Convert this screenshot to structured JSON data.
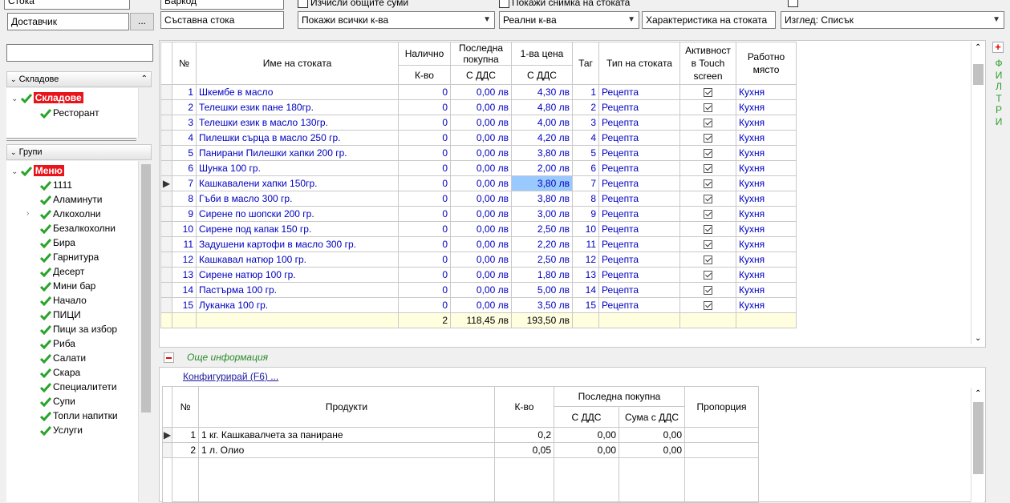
{
  "toolbar": {
    "stock_label": "Стока",
    "barcode_label": "Баркод",
    "calc_totals_label": "Изчисли общите суми",
    "show_photo_label": "Покажи снимка на стоката",
    "supplier_label": "Доставчик",
    "ellipsis_label": "...",
    "composite_label": "Съставна стока",
    "qty_filter_value": "Покажи всички к-ва",
    "real_qty_value": "Реални к-ва",
    "characteristic_label": "Характеристика на стоката",
    "view_value": "Изглед: Списък"
  },
  "left": {
    "warehouses_header": "Складове",
    "warehouses_root": "Складове",
    "warehouses_children": [
      "Ресторант"
    ],
    "groups_header": "Групи",
    "groups_root": "Меню",
    "groups": [
      "1111",
      "Аламинути",
      "Алкохолни",
      "Безалкохолни",
      "Бира",
      "Гарнитура",
      "Десерт",
      "Мини бар",
      "Начало",
      "ПИЦИ",
      "Пици за избор",
      "Риба",
      "Салати",
      "Скара",
      "Специалитети",
      "Супи",
      "Топли напитки",
      "Услуги"
    ]
  },
  "filters_label": "ФИЛТРИ",
  "main_grid": {
    "headers": {
      "no": "№",
      "name": "Име на стоката",
      "available": "Налично",
      "qty": "К-во",
      "last_purchase": "Последна покупна",
      "with_vat": "С ДДС",
      "first_price": "1-ва цена",
      "with_vat2": "С ДДС",
      "tag": "Таг",
      "type": "Тип на стоката",
      "touch": "Активност в Touch screen",
      "workplace": "Работно място"
    },
    "rows": [
      {
        "no": "1",
        "name": "Шкембе в масло",
        "qty": "0",
        "last": "0,00 лв",
        "price": "4,30 лв",
        "tag": "1",
        "type": "Рецепта",
        "wp": "Кухня"
      },
      {
        "no": "2",
        "name": "Телешки език пане 180гр.",
        "qty": "0",
        "last": "0,00 лв",
        "price": "4,80 лв",
        "tag": "2",
        "type": "Рецепта",
        "wp": "Кухня"
      },
      {
        "no": "3",
        "name": "Телешки език в масло 130гр.",
        "qty": "0",
        "last": "0,00 лв",
        "price": "4,00 лв",
        "tag": "3",
        "type": "Рецепта",
        "wp": "Кухня"
      },
      {
        "no": "4",
        "name": "Пилешки сърца в масло 250 гр.",
        "qty": "0",
        "last": "0,00 лв",
        "price": "4,20 лв",
        "tag": "4",
        "type": "Рецепта",
        "wp": "Кухня"
      },
      {
        "no": "5",
        "name": "Панирани Пилешки хапки 200 гр.",
        "qty": "0",
        "last": "0,00 лв",
        "price": "3,80 лв",
        "tag": "5",
        "type": "Рецепта",
        "wp": "Кухня"
      },
      {
        "no": "6",
        "name": "Шунка 100 гр.",
        "qty": "0",
        "last": "0,00 лв",
        "price": "2,00 лв",
        "tag": "6",
        "type": "Рецепта",
        "wp": "Кухня"
      },
      {
        "no": "7",
        "name": "Кашкавалени хапки 150гр.",
        "qty": "0",
        "last": "0,00 лв",
        "price": "3,80 лв",
        "tag": "7",
        "type": "Рецепта",
        "wp": "Кухня"
      },
      {
        "no": "8",
        "name": "Гъби в масло 300 гр.",
        "qty": "0",
        "last": "0,00 лв",
        "price": "3,80 лв",
        "tag": "8",
        "type": "Рецепта",
        "wp": "Кухня"
      },
      {
        "no": "9",
        "name": "Сирене по шопски 200 гр.",
        "qty": "0",
        "last": "0,00 лв",
        "price": "3,00 лв",
        "tag": "9",
        "type": "Рецепта",
        "wp": "Кухня"
      },
      {
        "no": "10",
        "name": "Сирене под капак 150 гр.",
        "qty": "0",
        "last": "0,00 лв",
        "price": "2,50 лв",
        "tag": "10",
        "type": "Рецепта",
        "wp": "Кухня"
      },
      {
        "no": "11",
        "name": "Задушени картофи в масло 300 гр.",
        "qty": "0",
        "last": "0,00 лв",
        "price": "2,20 лв",
        "tag": "11",
        "type": "Рецепта",
        "wp": "Кухня"
      },
      {
        "no": "12",
        "name": "Кашкавал натюр 100 гр.",
        "qty": "0",
        "last": "0,00 лв",
        "price": "2,50 лв",
        "tag": "12",
        "type": "Рецепта",
        "wp": "Кухня"
      },
      {
        "no": "13",
        "name": "Сирене натюр 100 гр.",
        "qty": "0",
        "last": "0,00 лв",
        "price": "1,80 лв",
        "tag": "13",
        "type": "Рецепта",
        "wp": "Кухня"
      },
      {
        "no": "14",
        "name": "Пастърма 100 гр.",
        "qty": "0",
        "last": "0,00 лв",
        "price": "5,00 лв",
        "tag": "14",
        "type": "Рецепта",
        "wp": "Кухня"
      },
      {
        "no": "15",
        "name": "Луканка 100 гр.",
        "qty": "0",
        "last": "0,00 лв",
        "price": "3,50 лв",
        "tag": "15",
        "type": "Рецепта",
        "wp": "Кухня"
      }
    ],
    "totals": {
      "qty": "2",
      "last": "118,45 лв",
      "price": "193,50 лв"
    }
  },
  "more_info": {
    "label": "Още информация",
    "configure_link": "Конфигурирай (F6) ..."
  },
  "sub_grid": {
    "headers": {
      "no": "№",
      "products": "Продукти",
      "qty": "К-во",
      "last_purchase": "Последна покупна",
      "with_vat": "С ДДС",
      "sum_vat": "Сума с ДДС",
      "ratio": "Пропорция"
    },
    "rows": [
      {
        "no": "1",
        "product": "1 кг. Кашкавалчета за паниране",
        "qty": "0,2",
        "vat": "0,00",
        "sum": "0,00"
      },
      {
        "no": "2",
        "product": "1 л. Олио",
        "qty": "0,05",
        "vat": "0,00",
        "sum": "0,00"
      }
    ]
  }
}
